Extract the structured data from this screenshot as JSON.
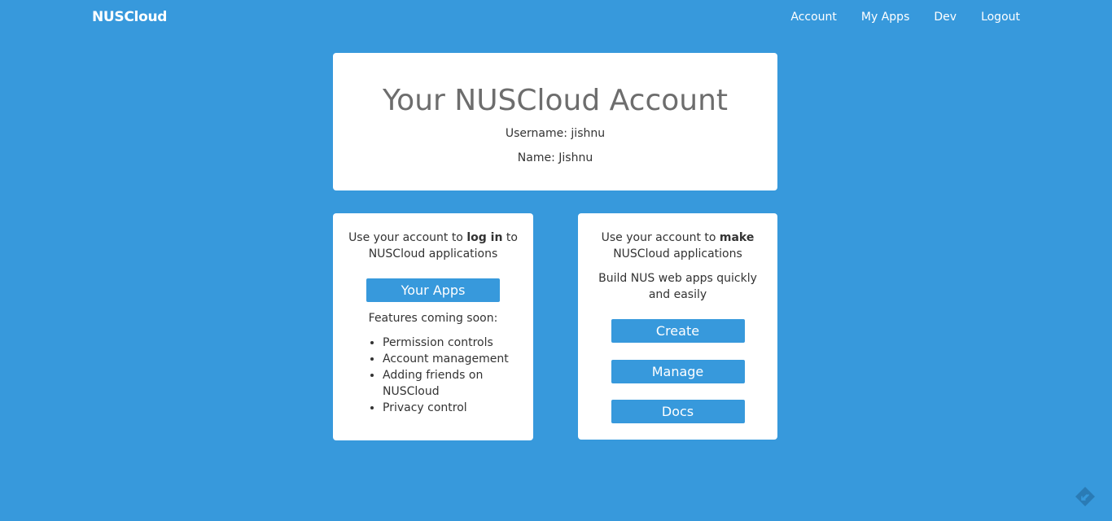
{
  "navbar": {
    "brand": "NUSCloud",
    "links": [
      "Account",
      "My Apps",
      "Dev",
      "Logout"
    ]
  },
  "account": {
    "title": "Your NUSCloud Account",
    "username_line": "Username: jishnu",
    "name_line": "Name: Jishnu"
  },
  "login_card": {
    "text_before": "Use your account to ",
    "text_bold": "log in",
    "text_after": " to NUSCloud applications",
    "button": "Your Apps",
    "features_heading": "Features coming soon:",
    "features": [
      "Permission controls",
      "Account management",
      "Adding friends on NUSCloud",
      "Privacy control"
    ]
  },
  "make_card": {
    "text_before": "Use your account to ",
    "text_bold": "make",
    "text_after": " NUSCloud applications",
    "sub_text": "Build NUS web apps quickly and easily",
    "buttons": [
      "Create",
      "Manage",
      "Docs"
    ]
  },
  "colors": {
    "background": "#3799dc",
    "card": "#ffffff",
    "title": "#6d6d6d"
  },
  "icons": {
    "corner": "feedback-icon"
  }
}
